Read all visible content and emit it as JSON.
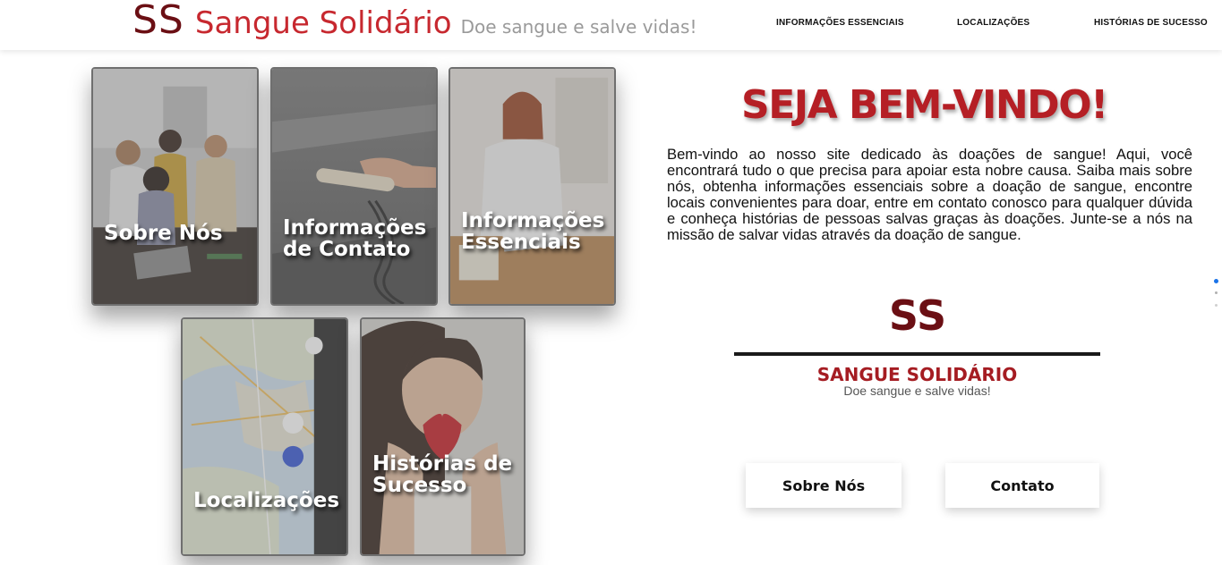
{
  "header": {
    "logo_mark": "SS",
    "site_name": "Sangue Solidário",
    "tagline": "Doe sangue e salve vidas!",
    "nav": [
      {
        "label": "INFORMAÇÕES ESSENCIAIS"
      },
      {
        "label": "LOCALIZAÇÕES"
      },
      {
        "label": "HISTÓRIAS DE SUCESSO"
      }
    ]
  },
  "cards": [
    {
      "title": "Sobre Nós",
      "image": "team-around-laptop"
    },
    {
      "title": "Informações de Contato",
      "image": "hand-holding-phone-receiver"
    },
    {
      "title": "Informações Essenciais",
      "image": "doctor-writing-at-desk"
    },
    {
      "title": "Localizações",
      "image": "map-on-phone"
    },
    {
      "title": "Histórias de Sucesso",
      "image": "woman-holding-heart"
    }
  ],
  "main": {
    "welcome_title": "SEJA BEM-VINDO!",
    "intro_text": "Bem-vindo ao nosso site dedicado às doações de sangue! Aqui, você encontrará tudo o que precisa para apoiar esta nobre causa. Saiba mais sobre nós, obtenha informações essenciais sobre a doação de sangue, encontre locais convenientes para doar, entre em contato conosco para qualquer dúvida e conheça histórias de pessoas salvas graças às doações. Junte-se a nós na missão de salvar vidas através da doação de sangue.",
    "brand_mark": "SS",
    "brand_name": "SANGUE SOLIDÁRIO",
    "brand_tagline": "Doe sangue e salve vidas!",
    "buttons": [
      {
        "label": "Sobre Nós"
      },
      {
        "label": "Contato"
      }
    ]
  },
  "colors": {
    "brand_dark": "#6b0f14",
    "brand_red": "#c7282f",
    "accent_blue": "#1a73e8"
  }
}
